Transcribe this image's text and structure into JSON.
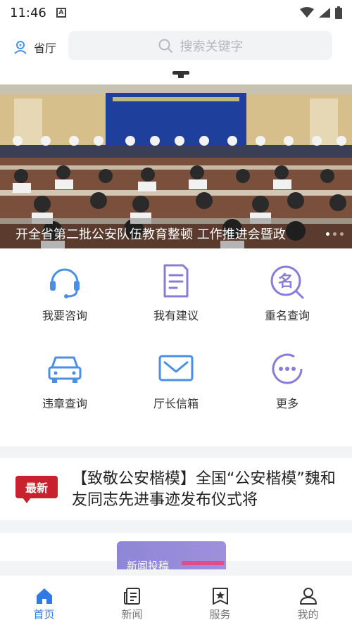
{
  "status_bar": {
    "time": "11:46",
    "icons": [
      "notification-a-icon",
      "wifi-icon",
      "signal-icon",
      "battery-icon"
    ]
  },
  "header": {
    "location_label": "省厅",
    "search_placeholder": "搜索关键字"
  },
  "banner": {
    "caption": "开全省第二批公安队伍教育整顿 工作推进会暨政",
    "slide_count": 3,
    "active_slide": 1
  },
  "services": [
    {
      "label": "我要咨询",
      "icon": "headset-icon"
    },
    {
      "label": "我有建议",
      "icon": "document-icon"
    },
    {
      "label": "重名查询",
      "icon": "name-search-icon"
    },
    {
      "label": "违章查询",
      "icon": "car-icon"
    },
    {
      "label": "厅长信箱",
      "icon": "mail-icon"
    },
    {
      "label": "更多",
      "icon": "more-icon"
    }
  ],
  "news_flash": {
    "badge": "最新",
    "headline": "【致敬公安楷模】全国“公安楷模”魏和友同志先进事迹发布仪式将"
  },
  "submit_card": {
    "label": "新闻投稿"
  },
  "tabbar": [
    {
      "label": "首页",
      "icon": "home-icon",
      "active": true
    },
    {
      "label": "新闻",
      "icon": "news-icon",
      "active": false
    },
    {
      "label": "服务",
      "icon": "service-star-icon",
      "active": false
    },
    {
      "label": "我的",
      "icon": "user-icon",
      "active": false
    }
  ],
  "colors": {
    "accent": "#2f7ae5",
    "badge_red": "#c7222e",
    "icon_blue": "#4a8fe7",
    "icon_purple": "#8a7bd8"
  }
}
